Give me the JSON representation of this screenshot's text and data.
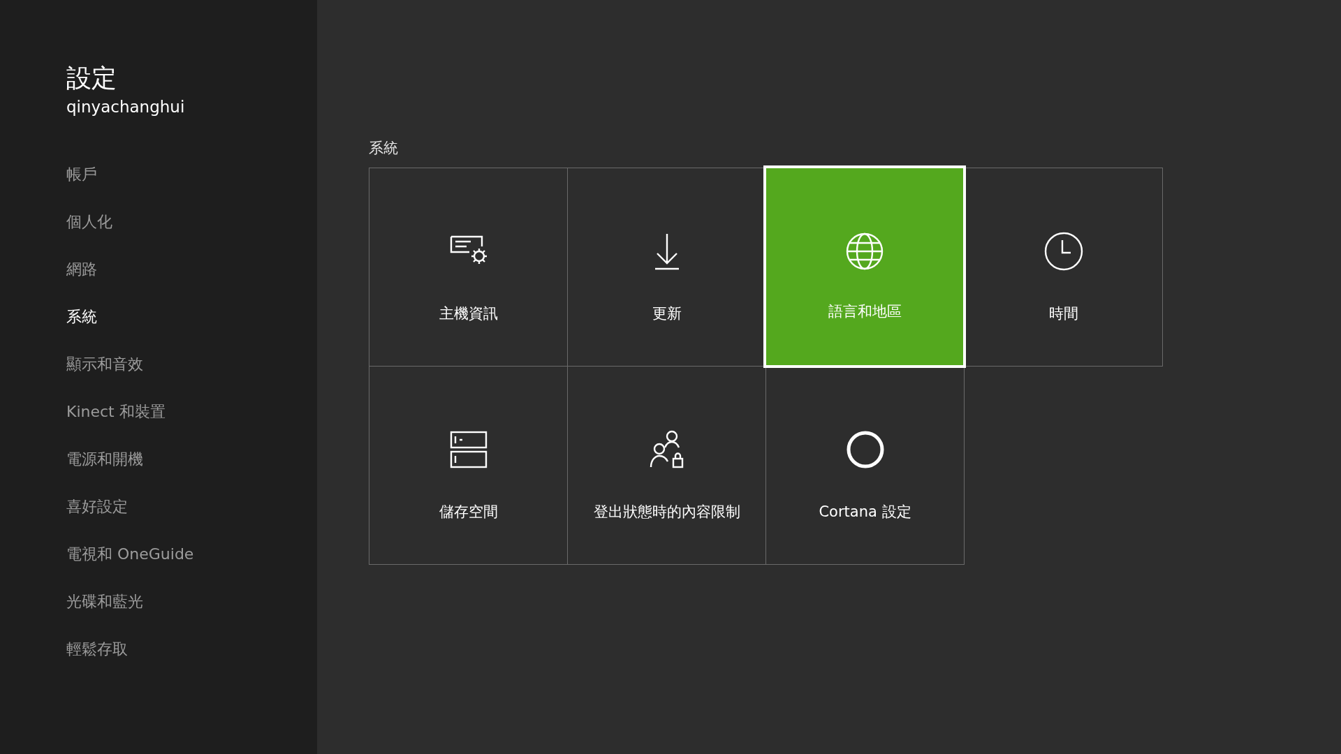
{
  "sidebar": {
    "title": "設定",
    "username": "qinyachanghui",
    "items": [
      {
        "label": "帳戶",
        "selected": false
      },
      {
        "label": "個人化",
        "selected": false
      },
      {
        "label": "網路",
        "selected": false
      },
      {
        "label": "系統",
        "selected": true
      },
      {
        "label": "顯示和音效",
        "selected": false
      },
      {
        "label": "Kinect 和裝置",
        "selected": false
      },
      {
        "label": "電源和開機",
        "selected": false
      },
      {
        "label": "喜好設定",
        "selected": false
      },
      {
        "label": "電視和 OneGuide",
        "selected": false
      },
      {
        "label": "光碟和藍光",
        "selected": false
      },
      {
        "label": "輕鬆存取",
        "selected": false
      }
    ]
  },
  "section": {
    "title": "系統",
    "tiles": [
      {
        "kind": "console",
        "label": "主機資訊",
        "selected": false
      },
      {
        "kind": "update",
        "label": "更新",
        "selected": false
      },
      {
        "kind": "language",
        "label": "語言和地區",
        "selected": true
      },
      {
        "kind": "time",
        "label": "時間",
        "selected": false
      },
      {
        "kind": "storage",
        "label": "儲存空間",
        "selected": false
      },
      {
        "kind": "restriction",
        "label": "登出狀態時的內容限制",
        "selected": false
      },
      {
        "kind": "cortana",
        "label": "Cortana 設定",
        "selected": false
      }
    ]
  }
}
